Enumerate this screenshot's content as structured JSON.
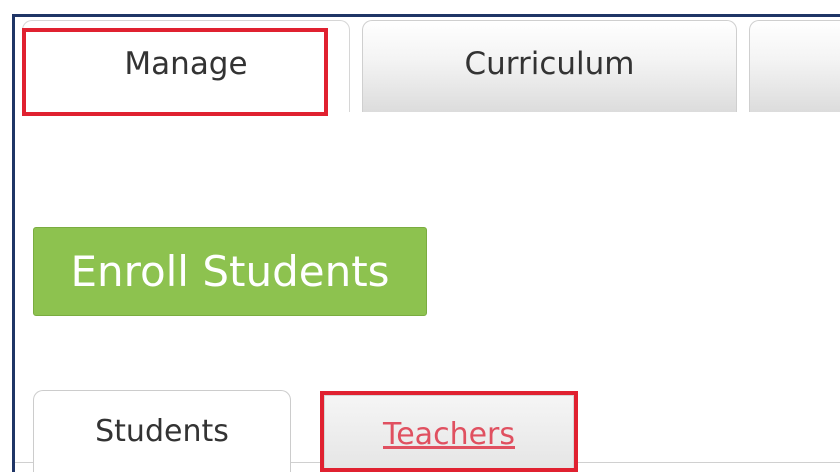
{
  "top_tabs": {
    "manage": "Manage",
    "curriculum": "Curriculum"
  },
  "enroll_button": {
    "label": "Enroll Students",
    "color": "#8dc24f"
  },
  "sub_tabs": {
    "students": "Students",
    "teachers": "Teachers"
  },
  "colors": {
    "highlight": "#e02130",
    "link": "#e05060",
    "frame": "#1f3566"
  }
}
